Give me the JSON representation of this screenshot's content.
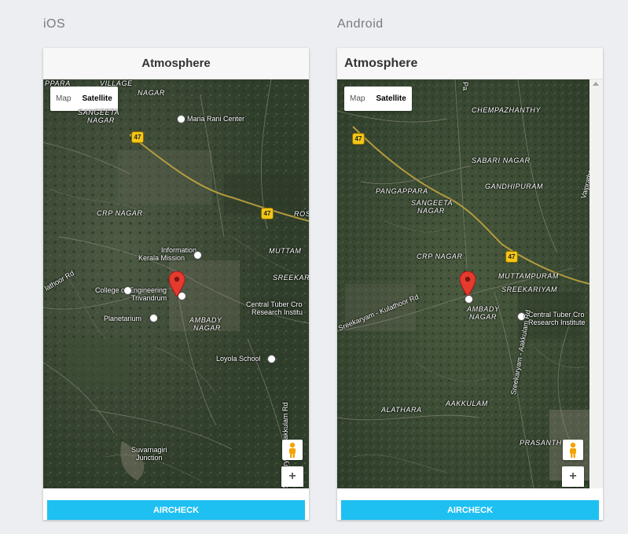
{
  "platforms": {
    "ios_label": "iOS",
    "android_label": "Android"
  },
  "ios": {
    "header_title": "Atmosphere",
    "map_toggle": {
      "map": "Map",
      "satellite": "Satellite",
      "selected": "Satellite"
    },
    "map_labels": {
      "village": "VILLAGE",
      "ppara": "PPARA",
      "nagar_tl": "NAGAR",
      "sangeeta": "SANGEETA",
      "nagar_tl2": "NAGAR",
      "maria_rani": "Maria Rani Center",
      "crp_nagar": "CRP NAGAR",
      "information": "Information",
      "kerala_mission": "Kerala Mission",
      "muttam": "MUTTAM",
      "sreekar": "SREEKAR",
      "kulathoor": "lathoor Rd",
      "college_1": "College of Engineering",
      "college_2": "Trivandrum",
      "ambady": "AMBADY",
      "ambady_nagar": "NAGAR",
      "planetarium": "Planetarium",
      "central_tuber_1": "Central Tuber Cro",
      "central_tuber_2": "Research Institu",
      "loyola": "Loyola School",
      "suvarnagiri_1": "Suvarnagiri",
      "suvarnagiri_2": "Junction",
      "aakkulam_rd": "Sreekaryam - Aakkulam Rd",
      "ros": "ROS"
    },
    "road_shields": [
      "47",
      "47"
    ],
    "action_button": "AIRCHECK"
  },
  "android": {
    "header_title": "Atmosphere",
    "map_toggle": {
      "map": "Map",
      "satellite": "Satellite",
      "selected": "Satellite"
    },
    "map_labels": {
      "chempazhanthy": "CHEMPAZHANTHY",
      "sabari_nagar": "SABARI NAGAR",
      "pangappara": "PANGAPPARA",
      "gandhipuram": "GANDHIPURAM",
      "sangeeta": "SANGEETA",
      "sangeeta_nagar": "NAGAR",
      "crp_nagar": "CRP NAGAR",
      "muttampuram": "MUTTAMPURAM",
      "sreekariyam": "SREEKARIYAM",
      "kulathoor_rd": "Sreekaryam - Kulathoor Rd",
      "ambady": "AMBADY",
      "ambady_nagar": "NAGAR",
      "central_tuber_1": "Central Tuber Cro",
      "central_tuber_2": "Research Institute",
      "alathara": "ALATHARA",
      "aakkulam": "AAKKULAM",
      "aakkulam_rd": "Sreekaryam - Aakkulam Rd",
      "prasanth": "PRASANTH",
      "vaiprathala": "Vaipratha",
      "pa": "Pa"
    },
    "road_shields": [
      "47",
      "47"
    ],
    "action_button": "AIRCHECK"
  },
  "map_controls": {
    "zoom_in": "+"
  }
}
